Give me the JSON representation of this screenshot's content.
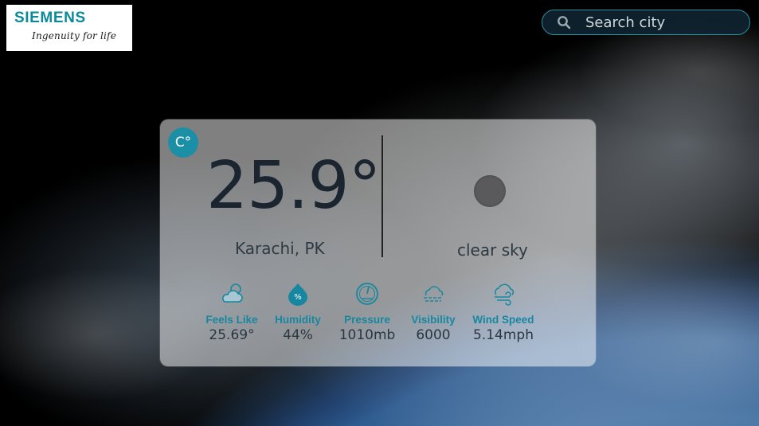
{
  "logo": {
    "brand": "SIEMENS",
    "tagline": "Ingenuity for life"
  },
  "search": {
    "placeholder": "Search city",
    "icon": "search-icon"
  },
  "weather": {
    "unit_toggle": "C°",
    "temperature": "25.9°",
    "location": "Karachi, PK",
    "condition": "clear sky",
    "condition_icon": "clear-sky-icon"
  },
  "stats": [
    {
      "label": "Feels Like",
      "value": "25.69°",
      "icon": "cloud-sun-icon"
    },
    {
      "label": "Humidity",
      "value": "44%",
      "icon": "humidity-drop-icon"
    },
    {
      "label": "Pressure",
      "value": "1010mb",
      "icon": "pressure-gauge-icon"
    },
    {
      "label": "Visibility",
      "value": "6000",
      "icon": "fog-icon"
    },
    {
      "label": "Wind Speed",
      "value": "5.14mph",
      "icon": "wind-cloud-icon"
    }
  ],
  "colors": {
    "accent": "#17879f",
    "toggle_bg": "#1b8fa5",
    "search_border": "#2b8ea2",
    "brand": "#0b8a9a"
  }
}
